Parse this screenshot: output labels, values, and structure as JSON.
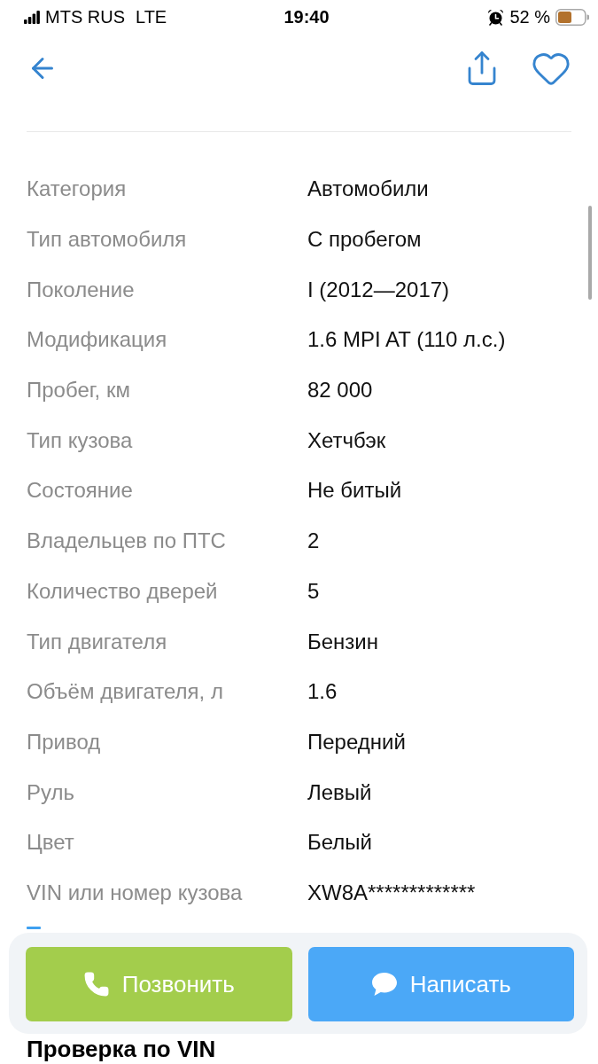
{
  "status_bar": {
    "carrier": "MTS RUS",
    "network": "LTE",
    "time": "19:40",
    "battery": "52 %"
  },
  "specs": [
    {
      "label": "Категория",
      "value": "Автомобили"
    },
    {
      "label": "Тип автомобиля",
      "value": "С пробегом"
    },
    {
      "label": "Поколение",
      "value": "I (2012—2017)"
    },
    {
      "label": "Модификация",
      "value": "1.6 MPI AT (110 л.с.)"
    },
    {
      "label": "Пробег, км",
      "value": "82 000"
    },
    {
      "label": "Тип кузова",
      "value": "Хетчбэк"
    },
    {
      "label": "Состояние",
      "value": "Не битый"
    },
    {
      "label": "Владельцев по ПТС",
      "value": "2"
    },
    {
      "label": "Количество дверей",
      "value": "5"
    },
    {
      "label": "Тип двигателя",
      "value": "Бензин"
    },
    {
      "label": "Объём двигателя, л",
      "value": "1.6"
    },
    {
      "label": "Привод",
      "value": "Передний"
    },
    {
      "label": "Руль",
      "value": "Левый"
    },
    {
      "label": "Цвет",
      "value": "Белый"
    },
    {
      "label": "VIN или номер кузова",
      "value": "XW8A*************"
    }
  ],
  "actions": [
    {
      "kind": "call",
      "label": "Позвонить"
    },
    {
      "kind": "message",
      "label": "Написать"
    }
  ],
  "next_section": {
    "title": "Проверка по VIN"
  }
}
